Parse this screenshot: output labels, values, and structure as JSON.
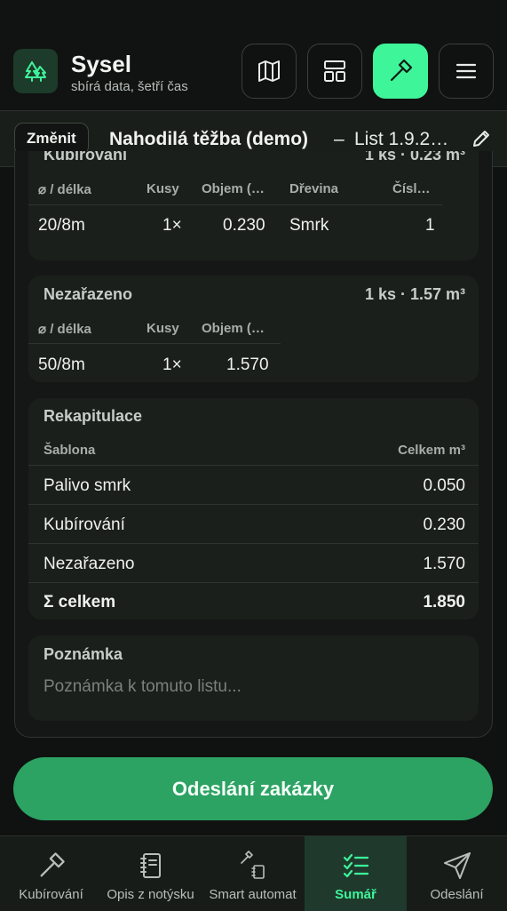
{
  "app": {
    "title": "Sysel",
    "subtitle": "sbírá data, šetří čas"
  },
  "header_buttons": [
    "map-icon",
    "layout-icon",
    "axe-icon",
    "menu-icon"
  ],
  "context": {
    "change_label": "Změnit",
    "title": "Nahodilá těžba (demo)",
    "separator": "–",
    "list": "List 1.9.2…"
  },
  "kubirovani": {
    "title": "Kubírování",
    "summary": "1 ks · 0.23 m³",
    "headers": [
      "⌀ / délka",
      "Kusy",
      "Objem (…",
      "Dřevina",
      "Čísl…"
    ],
    "rows": [
      [
        "20/8m",
        "1×",
        "0.230",
        "Smrk",
        "1"
      ]
    ]
  },
  "nezarazeno": {
    "title": "Nezařazeno",
    "summary": "1 ks · 1.57 m³",
    "headers": [
      "⌀ / délka",
      "Kusy",
      "Objem (…"
    ],
    "rows": [
      [
        "50/8m",
        "1×",
        "1.570"
      ]
    ]
  },
  "rekapitulace": {
    "title": "Rekapitulace",
    "col_template": "Šablona",
    "col_total": "Celkem m³",
    "rows": [
      {
        "name": "Palivo smrk",
        "value": "0.050"
      },
      {
        "name": "Kubírování",
        "value": "0.230"
      },
      {
        "name": "Nezařazeno",
        "value": "1.570"
      }
    ],
    "total_label": "Σ celkem",
    "total_value": "1.850"
  },
  "note": {
    "title": "Poznámka",
    "placeholder": "Poznámka k tomuto listu..."
  },
  "submit_label": "Odeslání zakázky",
  "nav": [
    {
      "label": "Kubírování",
      "icon": "axe-icon"
    },
    {
      "label": "Opis z notýsku",
      "icon": "notebook-icon"
    },
    {
      "label": "Smart automat",
      "icon": "smart-automat-icon"
    },
    {
      "label": "Sumář",
      "icon": "checklist-icon",
      "active": true
    },
    {
      "label": "Odeslání",
      "icon": "send-icon"
    }
  ],
  "colors": {
    "accent": "#3ef59a",
    "button": "#2ca263",
    "background": "#0f1210"
  }
}
